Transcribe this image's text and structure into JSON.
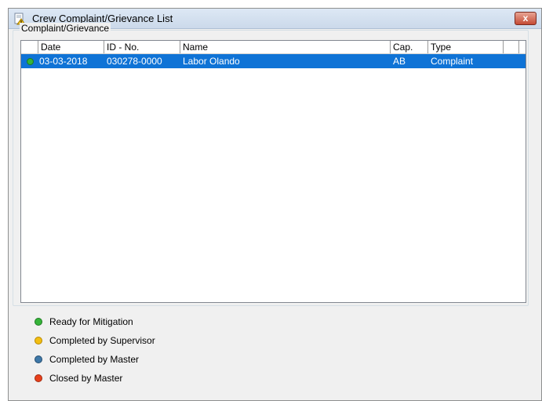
{
  "window": {
    "title": "Crew Complaint/Grievance List",
    "close_glyph": "x"
  },
  "group": {
    "label": "Complaint/Grievance"
  },
  "columns": [
    "Date",
    "ID - No.",
    "Name",
    "Cap.",
    "Type"
  ],
  "rows": [
    {
      "status": "green",
      "date": "03-03-2018",
      "id": "030278-0000",
      "name": "Labor  Olando",
      "cap": "AB",
      "type": "Complaint"
    }
  ],
  "legend": [
    {
      "label": "Ready for Mitigation",
      "color": "#36b43a"
    },
    {
      "label": "Completed by Supervisor",
      "color": "#f2be12"
    },
    {
      "label": "Completed by Master",
      "color": "#3f78a8"
    },
    {
      "label": "Closed by Master",
      "color": "#e8401c"
    }
  ],
  "colors": {
    "selection": "#0f73d6",
    "title_bar": "#cbd9ea",
    "close_button": "#c44a35"
  }
}
